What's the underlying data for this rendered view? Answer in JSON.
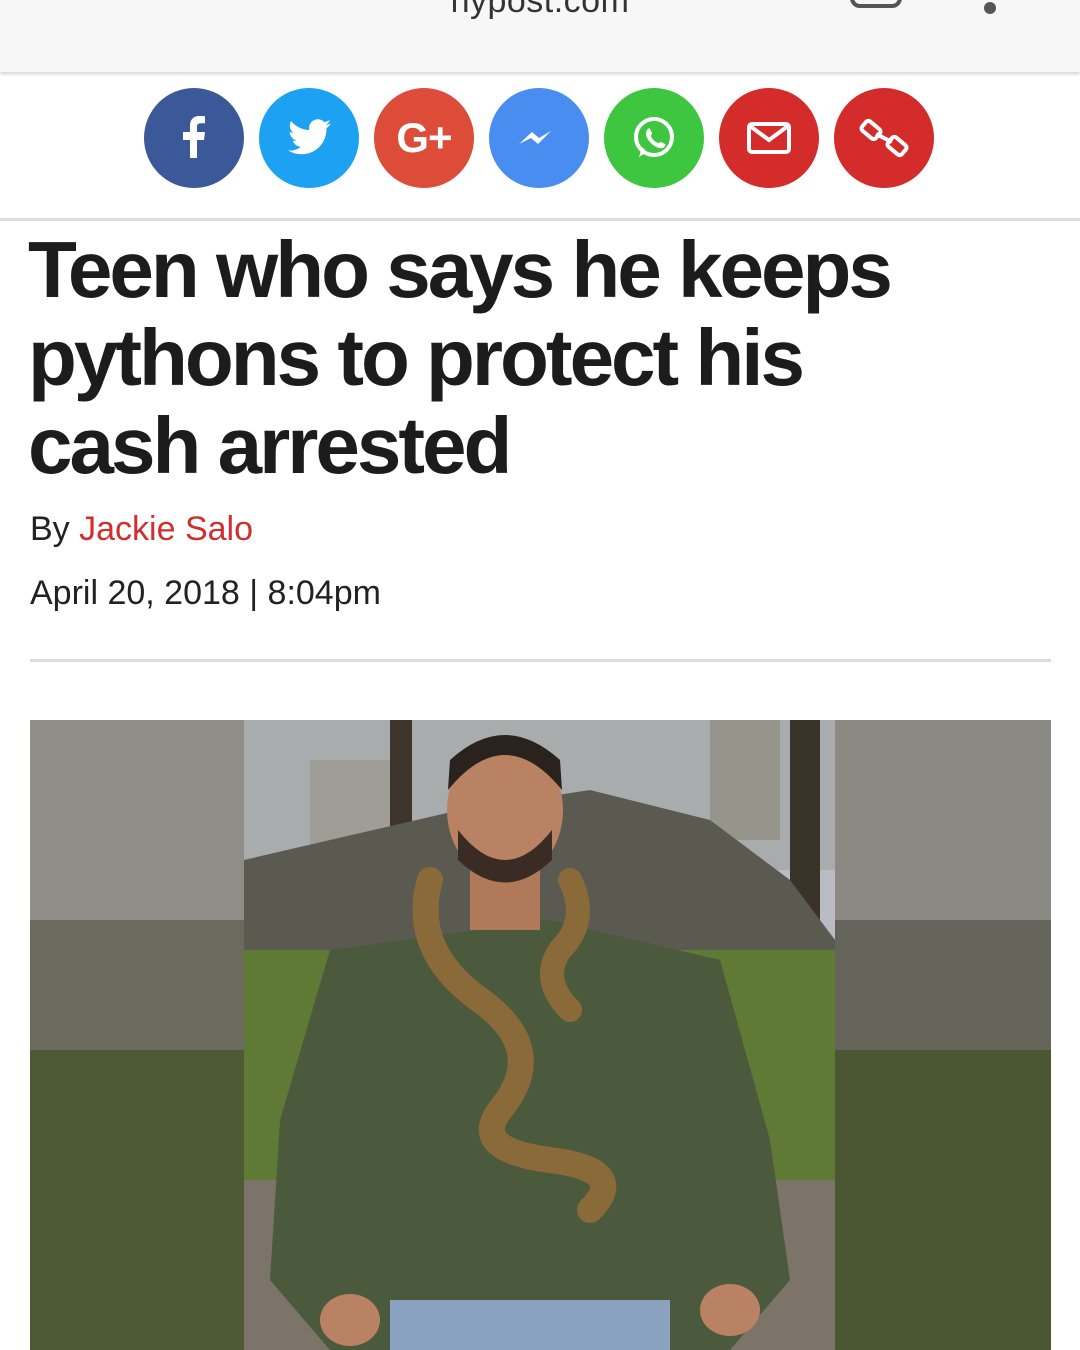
{
  "browser": {
    "url": "nypost.com"
  },
  "share": {
    "buttons": [
      {
        "name": "facebook",
        "color": "#3b5998",
        "icon": "facebook-icon"
      },
      {
        "name": "twitter",
        "color": "#1da1f2",
        "icon": "twitter-icon"
      },
      {
        "name": "google-plus",
        "color": "#dd4b39",
        "icon": "google-plus-icon"
      },
      {
        "name": "messenger",
        "color": "#4a8df0",
        "icon": "messenger-icon"
      },
      {
        "name": "whatsapp",
        "color": "#3ec640",
        "icon": "whatsapp-icon"
      },
      {
        "name": "email",
        "color": "#d42b2b",
        "icon": "mail-icon"
      },
      {
        "name": "copy-link",
        "color": "#d42b2b",
        "icon": "link-icon"
      }
    ],
    "google_plus_label": "G+"
  },
  "article": {
    "headline_lines": [
      "Teen who says he keeps",
      "pythons to protect his",
      "cash arrested"
    ],
    "by_label": "By",
    "author": "Jackie Salo",
    "date": "April 20, 2018 | 8:04pm",
    "author_color": "#d12e2e"
  }
}
